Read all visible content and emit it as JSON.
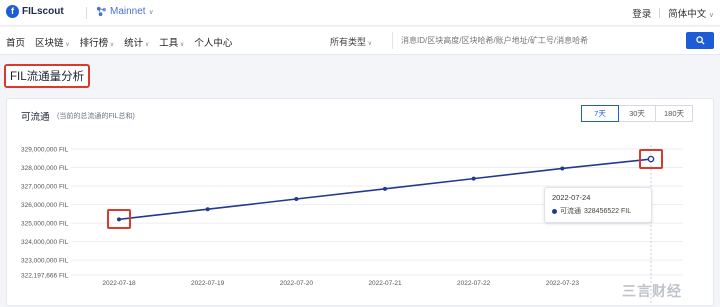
{
  "header": {
    "logo_text": "FILscout",
    "network": "Mainnet",
    "login": "登录",
    "language": "简体中文"
  },
  "nav": {
    "items": [
      "首页",
      "区块链",
      "排行榜",
      "统计",
      "工具",
      "个人中心"
    ],
    "type_select": "所有类型",
    "search_placeholder": "消息ID/区块高度/区块哈希/账户地址/矿工号/消息哈希"
  },
  "page": {
    "title": "FIL流通量分析"
  },
  "card": {
    "title": "可流通",
    "subtitle": "(当前的总流通的FIL总和)",
    "range_buttons": [
      {
        "label": "7天",
        "active": true
      },
      {
        "label": "30天",
        "active": false
      },
      {
        "label": "180天",
        "active": false
      }
    ]
  },
  "chart_data": {
    "type": "line",
    "title": "",
    "xlabel": "",
    "ylabel": "",
    "ylim": [
      322197666,
      329000000
    ],
    "y_ticks": [
      {
        "value": 329000000,
        "label": "329,000,000  FIL"
      },
      {
        "value": 328000000,
        "label": "328,000,000  FIL"
      },
      {
        "value": 327000000,
        "label": "327,000,000  FIL"
      },
      {
        "value": 326000000,
        "label": "326,000,000  FIL"
      },
      {
        "value": 325000000,
        "label": "325,000,000  FIL"
      },
      {
        "value": 324000000,
        "label": "324,000,000  FIL"
      },
      {
        "value": 323000000,
        "label": "323,000,000  FIL"
      },
      {
        "value": 322197666,
        "label": "322,197,666  FIL"
      }
    ],
    "categories": [
      "2022-07-18",
      "2022-07-19",
      "2022-07-20",
      "2022-07-21",
      "2022-07-22",
      "2022-07-23",
      "2022-07-24"
    ],
    "x_tick_labels": [
      "2022-07-18",
      "2022-07-19",
      "2022-07-20",
      "2022-07-21",
      "2022-07-22",
      "2022-07-23"
    ],
    "series": [
      {
        "name": "可流通",
        "color": "#233a8c",
        "values": [
          325200000,
          325750000,
          326300000,
          326850000,
          327400000,
          327950000,
          328456522
        ]
      }
    ],
    "grid": true,
    "tooltip": {
      "date": "2022-07-24",
      "series_label": "可流通",
      "value_text": "328456522 FIL"
    }
  },
  "watermark": "三言财经"
}
